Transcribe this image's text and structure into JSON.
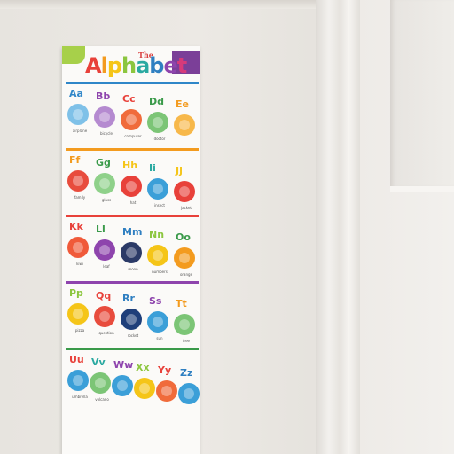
{
  "poster": {
    "title_small": "The",
    "title_letters": [
      {
        "ch": "A",
        "color": "#e8413a"
      },
      {
        "ch": "l",
        "color": "#f39b1f"
      },
      {
        "ch": "p",
        "color": "#f5c518"
      },
      {
        "ch": "h",
        "color": "#8cc63f"
      },
      {
        "ch": "a",
        "color": "#2aa9a1"
      },
      {
        "ch": "b",
        "color": "#2f7fc1"
      },
      {
        "ch": "e",
        "color": "#8e44ad"
      },
      {
        "ch": "t",
        "color": "#d63a7a"
      }
    ],
    "brand": "",
    "rows": [
      {
        "line": "#2f86c8",
        "cells": [
          {
            "letters": "Aa",
            "color": "#2f86c8",
            "word": "airplane",
            "pic": "#7fc1e8"
          },
          {
            "letters": "Bb",
            "color": "#8e44ad",
            "word": "bicycle",
            "pic": "#b58ad0"
          },
          {
            "letters": "Cc",
            "color": "#e8413a",
            "word": "computer",
            "pic": "#f06b3b"
          },
          {
            "letters": "Dd",
            "color": "#3a9a4a",
            "word": "doctor",
            "pic": "#7cc576"
          },
          {
            "letters": "Ee",
            "color": "#f39b1f",
            "word": "",
            "pic": "#f7b84a"
          }
        ]
      },
      {
        "line": "#f39b1f",
        "cells": [
          {
            "letters": "Ff",
            "color": "#f39b1f",
            "word": "family",
            "pic": "#e84c3d"
          },
          {
            "letters": "Gg",
            "color": "#3a9a4a",
            "word": "glass",
            "pic": "#8fd18a"
          },
          {
            "letters": "Hh",
            "color": "#f5c518",
            "word": "hat",
            "pic": "#e8413a"
          },
          {
            "letters": "Ii",
            "color": "#2aa9a1",
            "word": "insect",
            "pic": "#3b9fd8"
          },
          {
            "letters": "Jj",
            "color": "#f5c518",
            "word": "jacket",
            "pic": "#e8413a"
          }
        ]
      },
      {
        "line": "#e8413a",
        "cells": [
          {
            "letters": "Kk",
            "color": "#e8413a",
            "word": "kiwi",
            "pic": "#f05a3a"
          },
          {
            "letters": "Ll",
            "color": "#3a9a4a",
            "word": "leaf",
            "pic": "#8e44ad"
          },
          {
            "letters": "Mm",
            "color": "#2f7fc1",
            "word": "moon",
            "pic": "#2b3a67"
          },
          {
            "letters": "Nn",
            "color": "#8cc63f",
            "word": "numbers",
            "pic": "#f5c518"
          },
          {
            "letters": "Oo",
            "color": "#3a9a4a",
            "word": "orange",
            "pic": "#f39b1f"
          }
        ]
      },
      {
        "line": "#8e44ad",
        "cells": [
          {
            "letters": "Pp",
            "color": "#8cc63f",
            "word": "pizza",
            "pic": "#f5c518"
          },
          {
            "letters": "Qq",
            "color": "#e8413a",
            "word": "question",
            "pic": "#e84c3d"
          },
          {
            "letters": "Rr",
            "color": "#2f7fc1",
            "word": "rocket",
            "pic": "#1f3f7a"
          },
          {
            "letters": "Ss",
            "color": "#8e44ad",
            "word": "sun",
            "pic": "#3b9fd8"
          },
          {
            "letters": "Tt",
            "color": "#f39b1f",
            "word": "tree",
            "pic": "#7cc576"
          }
        ]
      },
      {
        "line": "#3a9a4a",
        "cells": [
          {
            "letters": "Uu",
            "color": "#e8413a",
            "word": "umbrella",
            "pic": "#3b9fd8"
          },
          {
            "letters": "Vv",
            "color": "#2aa9a1",
            "word": "volcano",
            "pic": "#7cc576"
          },
          {
            "letters": "Ww",
            "color": "#8e44ad",
            "word": "",
            "pic": "#3b9fd8"
          },
          {
            "letters": "Xx",
            "color": "#8cc63f",
            "word": "",
            "pic": "#f5c518"
          },
          {
            "letters": "Yy",
            "color": "#e8413a",
            "word": "",
            "pic": "#f06b3b"
          },
          {
            "letters": "Zz",
            "color": "#2f7fc1",
            "word": "",
            "pic": "#3b9fd8"
          }
        ]
      }
    ]
  }
}
